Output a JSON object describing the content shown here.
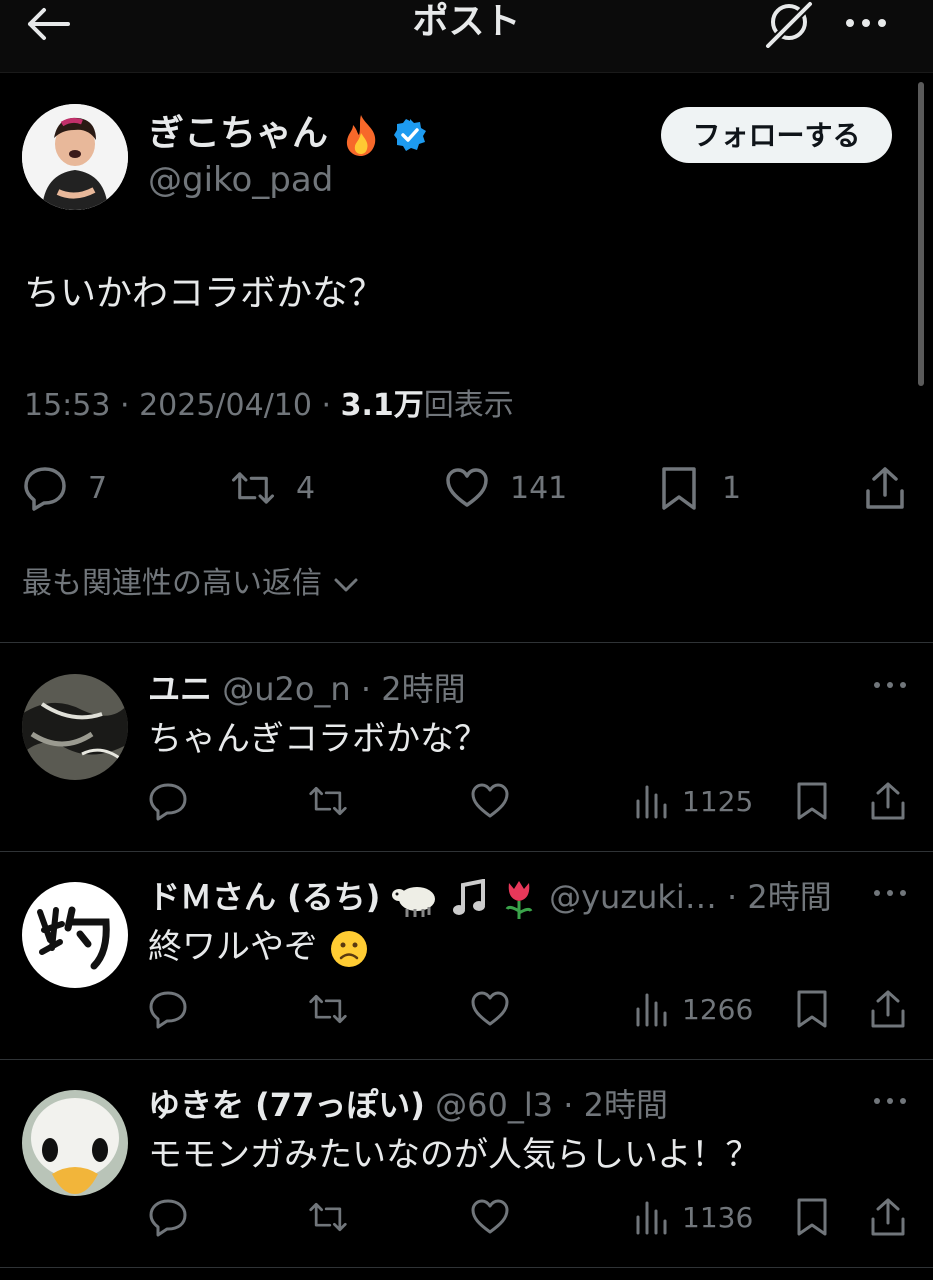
{
  "header": {
    "title": "ポスト"
  },
  "post": {
    "author_name": "ぎこちゃん",
    "author_handle": "@giko_pad",
    "follow_label": "フォローする",
    "text": "ちいかわコラボかな？",
    "time": "15:53 · 2025/04/10 · ",
    "views_count": "3.1万",
    "views_label": "回表示",
    "replies": "7",
    "reposts": "4",
    "likes": "141",
    "bookmarks": "1"
  },
  "sort": {
    "label": "最も関連性の高い返信"
  },
  "replies": [
    {
      "name": "ユニ",
      "handle": "@u2o_n · 2時間",
      "text": "ちゃんぎコラボかな？",
      "views": "1125"
    },
    {
      "name": "ドＭさん (るち)",
      "handle": "@yuzuki… · 2時間",
      "text": "終ワルやぞ",
      "views": "1266"
    },
    {
      "name": "ゆきを (77っぽい)",
      "handle": "@60_l3 · 2時間",
      "text": "モモンガみたいなのが人気らしいよ！？",
      "views": "1136"
    }
  ],
  "colors": {
    "background": "#000000",
    "text": "#e7e9ea",
    "muted": "#71767b",
    "verified": "#1d9bf0",
    "button_bg": "#eff3f4"
  }
}
